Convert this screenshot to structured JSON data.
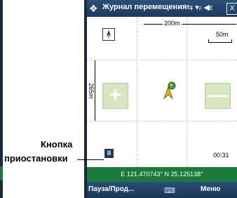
{
  "window": {
    "title": "Журнал перемещения",
    "status_icons": "⇆ ▾ᵢₗ ◀ϵ",
    "close_label": "X"
  },
  "map": {
    "distance_top": "200m",
    "distance_left": "265m",
    "scale_label": "50m",
    "zoom_in_label": "+",
    "zoom_out_label": "—",
    "timer": "00:31",
    "pause_icon_label": "II"
  },
  "coordinates": "E 121.470743°  N 25.125138°",
  "softkeys": {
    "left": "Пауза/Прод...",
    "center_icon": "⌨",
    "right": "Меню"
  },
  "callout": {
    "line1": "Кнопка",
    "line2": "приостановки"
  },
  "colors": {
    "titlebar": "#1c3b60",
    "coords_bar": "#1a7a3a",
    "zoom_button": "#d6e6c0"
  }
}
